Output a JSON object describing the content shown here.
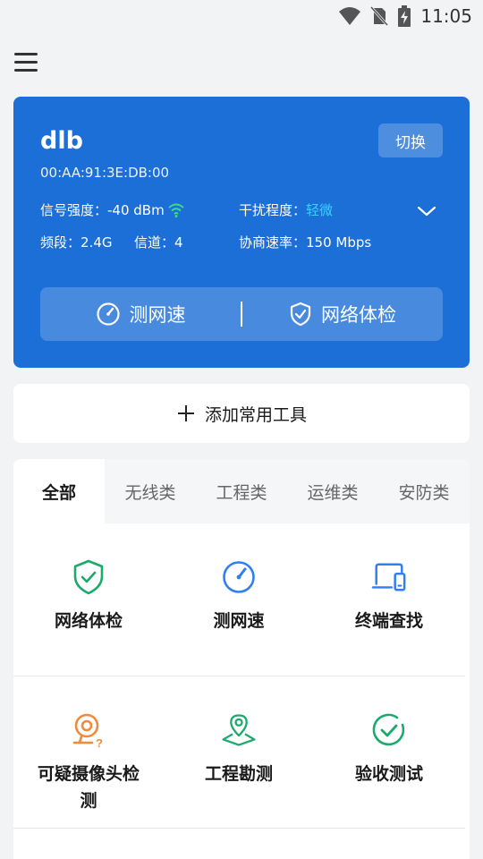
{
  "status_bar": {
    "time": "11:05",
    "icons": [
      "wifi-signal-icon",
      "no-sim-icon",
      "battery-charging-icon"
    ]
  },
  "app_bar": {
    "menu_icon": "hamburger-menu-icon"
  },
  "wifi_card": {
    "ssid": "dlb",
    "mac": "00:AA:91:3E:DB:00",
    "switch_label": "切换",
    "signal_label": "信号强度：",
    "signal_value": "-40 dBm",
    "interference_label": "干扰程度：",
    "interference_value": "轻微",
    "band_label": "频段：",
    "band_value": "2.4G",
    "channel_label": "信道：",
    "channel_value": "4",
    "rate_label": "协商速率：",
    "rate_value": "150 Mbps",
    "speed_test_label": "测网速",
    "network_check_label": "网络体检",
    "accent_color": "#1b6fd6",
    "highlight_color": "#37d3ff"
  },
  "add_tools": {
    "label": "添加常用工具"
  },
  "tabs": [
    {
      "label": "全部",
      "active": true
    },
    {
      "label": "无线类",
      "active": false
    },
    {
      "label": "工程类",
      "active": false
    },
    {
      "label": "运维类",
      "active": false
    },
    {
      "label": "安防类",
      "active": false
    }
  ],
  "tools": [
    {
      "label": "网络体检",
      "icon": "shield-check-icon",
      "color": "#1aaa6b"
    },
    {
      "label": "测网速",
      "icon": "speedometer-icon",
      "color": "#2f7ff0"
    },
    {
      "label": "终端查找",
      "icon": "devices-icon",
      "color": "#2f7ff0"
    },
    {
      "label": "可疑摄像头检测",
      "icon": "camera-question-icon",
      "color": "#f08a3c"
    },
    {
      "label": "工程勘测",
      "icon": "map-pin-icon",
      "color": "#1aaa6b"
    },
    {
      "label": "验收测试",
      "icon": "check-circle-icon",
      "color": "#1aaa6b"
    }
  ]
}
